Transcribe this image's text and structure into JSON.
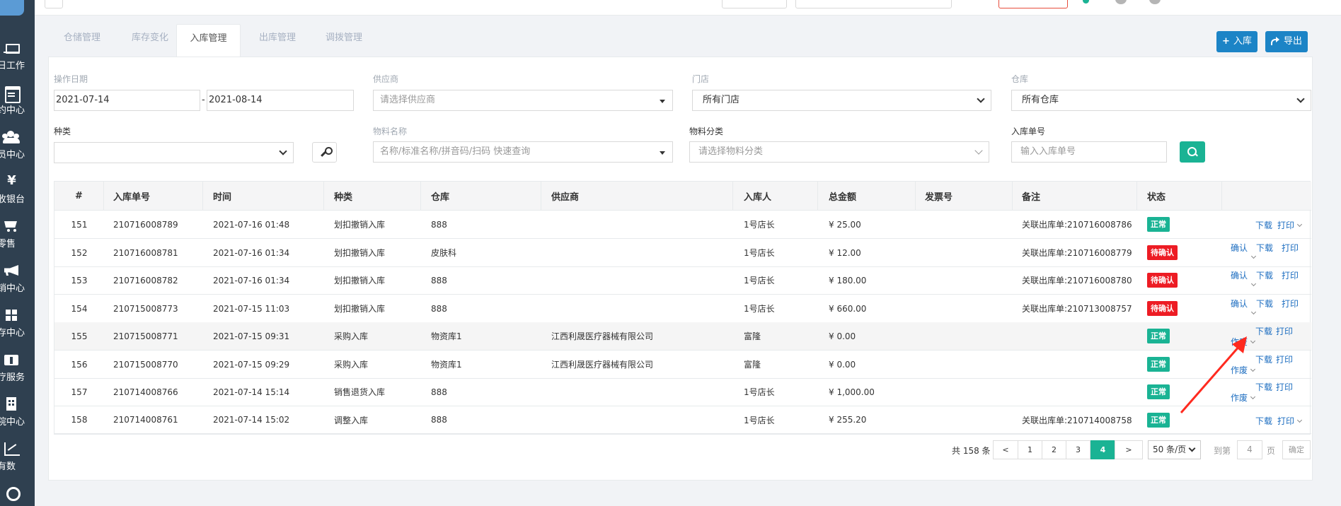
{
  "sidebar": {
    "items": [
      {
        "icon": "laptop-icon",
        "label": "日工作"
      },
      {
        "icon": "calendar-icon",
        "label": "约中心"
      },
      {
        "icon": "users-icon",
        "label": "员中心"
      },
      {
        "icon": "yen-icon",
        "glyph": "¥",
        "label": "收银台"
      },
      {
        "icon": "cart-icon",
        "label": "零售"
      },
      {
        "icon": "bullhorn-icon",
        "label": "销中心"
      },
      {
        "icon": "grid-icon",
        "label": "存中心"
      },
      {
        "icon": "medkit-icon",
        "label": "疗服务"
      },
      {
        "icon": "hospital-icon",
        "label": "院中心"
      },
      {
        "icon": "line-chart-icon",
        "label": "有数"
      },
      {
        "icon": "support-icon",
        "label": ""
      }
    ]
  },
  "tabs": [
    {
      "label": "仓储管理",
      "active": false
    },
    {
      "label": "库存变化",
      "active": false
    },
    {
      "label": "入库管理",
      "active": true
    },
    {
      "label": "出库管理",
      "active": false
    },
    {
      "label": "调拨管理",
      "active": false
    }
  ],
  "actions": {
    "stock_in_label": "入库",
    "export_label": "导出"
  },
  "filters": {
    "op_date_label": "操作日期",
    "date_from": "2021-07-14",
    "date_sep": "-",
    "date_to": "2021-08-14",
    "supplier_label": "供应商",
    "supplier_placeholder": "请选择供应商",
    "store_label": "门店",
    "store_value": "所有门店",
    "warehouse_label": "仓库",
    "warehouse_value": "所有仓库",
    "kind_label": "种类",
    "kind_value": "",
    "material_label": "物料名称",
    "material_placeholder": "名称/标准名称/拼音码/扫码 快速查询",
    "material_cat_label": "物料分类",
    "material_cat_placeholder": "请选择物料分类",
    "order_no_label": "入库单号",
    "order_no_placeholder": "输入入库单号"
  },
  "table": {
    "headers": [
      "#",
      "入库单号",
      "时间",
      "种类",
      "仓库",
      "供应商",
      "入库人",
      "总金额",
      "发票号",
      "备注",
      "状态",
      ""
    ],
    "rows": [
      {
        "no": "151",
        "order": "210716008789",
        "time": "2021-07-16 01:48",
        "kind": "划扣撤销入库",
        "wh": "888",
        "supplier": "",
        "person": "1号店长",
        "amount": "¥ 25.00",
        "invoice": "",
        "note": "关联出库单:210716008786",
        "status": "正常",
        "status_type": "ok"
      },
      {
        "no": "152",
        "order": "210716008781",
        "time": "2021-07-16 01:34",
        "kind": "划扣撤销入库",
        "wh": "皮肤科",
        "supplier": "",
        "person": "1号店长",
        "amount": "¥ 12.00",
        "invoice": "",
        "note": "关联出库单:210716008779",
        "status": "待确认",
        "status_type": "pend"
      },
      {
        "no": "153",
        "order": "210716008782",
        "time": "2021-07-16 01:34",
        "kind": "划扣撤销入库",
        "wh": "888",
        "supplier": "",
        "person": "1号店长",
        "amount": "¥ 180.00",
        "invoice": "",
        "note": "关联出库单:210716008780",
        "status": "待确认",
        "status_type": "pend"
      },
      {
        "no": "154",
        "order": "210715008773",
        "time": "2021-07-15 11:03",
        "kind": "划扣撤销入库",
        "wh": "888",
        "supplier": "",
        "person": "1号店长",
        "amount": "¥ 660.00",
        "invoice": "",
        "note": "关联出库单:210713008757",
        "status": "待确认",
        "status_type": "pend"
      },
      {
        "no": "155",
        "order": "210715008771",
        "time": "2021-07-15 09:31",
        "kind": "采购入库",
        "wh": "物资库1",
        "supplier": "江西利晟医疗器械有限公司",
        "person": "富隆",
        "amount": "¥ 0.00",
        "invoice": "",
        "note": "",
        "status": "正常",
        "status_type": "ok"
      },
      {
        "no": "156",
        "order": "210715008770",
        "time": "2021-07-15 09:29",
        "kind": "采购入库",
        "wh": "物资库1",
        "supplier": "江西利晟医疗器械有限公司",
        "person": "富隆",
        "amount": "¥ 0.00",
        "invoice": "",
        "note": "",
        "status": "正常",
        "status_type": "ok"
      },
      {
        "no": "157",
        "order": "210714008766",
        "time": "2021-07-14 15:14",
        "kind": "销售退货入库",
        "wh": "888",
        "supplier": "",
        "person": "1号店长",
        "amount": "¥ 1,000.00",
        "invoice": "",
        "note": "",
        "status": "正常",
        "status_type": "ok"
      },
      {
        "no": "158",
        "order": "210714008761",
        "time": "2021-07-14 15:02",
        "kind": "调整入库",
        "wh": "888",
        "supplier": "",
        "person": "1号店长",
        "amount": "¥ 255.20",
        "invoice": "",
        "note": "关联出库单:210714008758",
        "status": "正常",
        "status_type": "ok"
      }
    ],
    "row_actions": {
      "confirm": "确认",
      "download": "下载",
      "print": "打印",
      "void": "作废"
    }
  },
  "pager": {
    "total": "共 158 条",
    "prev": "<",
    "pages": [
      "1",
      "2",
      "3",
      "4"
    ],
    "active_page": "4",
    "next": ">",
    "page_size": "50 条/页",
    "goto_label": "到第",
    "goto_value": "4",
    "page_unit": "页",
    "confirm": "确定"
  },
  "colors": {
    "sidebar": "#2f4050",
    "primary": "#1c84c6",
    "success": "#1ab394",
    "danger": "#ed1c24",
    "annotation": "#ff2a1f"
  }
}
